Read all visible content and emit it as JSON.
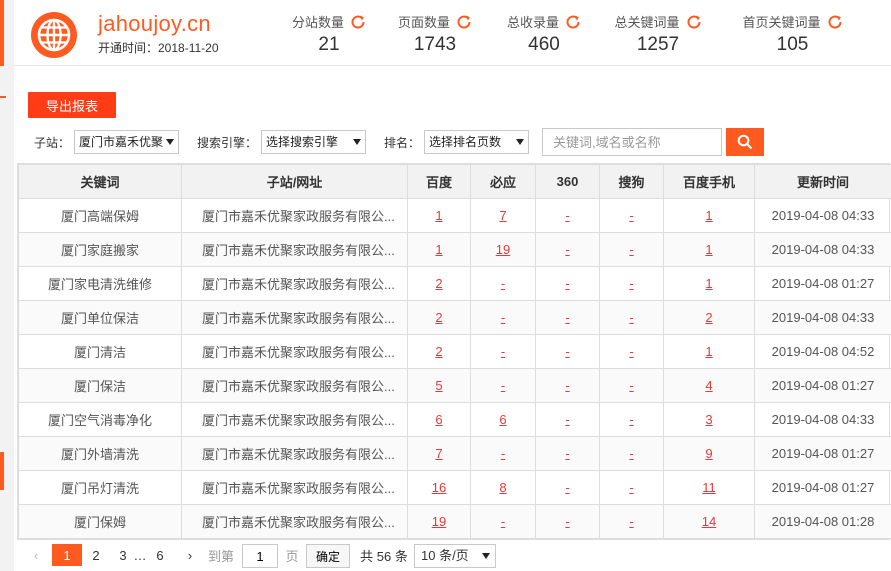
{
  "header": {
    "site_name": "jahoujoy.cn",
    "open_time": "开通时间：2018-11-20",
    "stats": [
      {
        "label": "分站数量",
        "value": "21"
      },
      {
        "label": "页面数量",
        "value": "1743"
      },
      {
        "label": "总收录量",
        "value": "460"
      },
      {
        "label": "总关键词量",
        "value": "1257"
      },
      {
        "label": "首页关键词量",
        "value": "105"
      }
    ]
  },
  "toolbar": {
    "export_label": "导出报表",
    "substation_label": "子站：",
    "substation_value": "厦门市嘉禾优聚",
    "engine_label": "搜索引擎：",
    "engine_value": "选择搜索引擎",
    "rank_label": "排名：",
    "rank_value": "选择排名页数",
    "search_placeholder": "关键词,域名或名称"
  },
  "table": {
    "headers": [
      "关键词",
      "子站/网址",
      "百度",
      "必应",
      "360",
      "搜狗",
      "百度手机",
      "更新时间"
    ],
    "rows": [
      {
        "kw": "厦门高端保姆",
        "site": "厦门市嘉禾优聚家政服务有限公...",
        "baidu": "1",
        "bing": "7",
        "s360": "-",
        "sogou": "-",
        "mobile": "1",
        "time": "2019-04-08 04:33"
      },
      {
        "kw": "厦门家庭搬家",
        "site": "厦门市嘉禾优聚家政服务有限公...",
        "baidu": "1",
        "bing": "19",
        "s360": "-",
        "sogou": "-",
        "mobile": "1",
        "time": "2019-04-08 04:33"
      },
      {
        "kw": "厦门家电清洗维修",
        "site": "厦门市嘉禾优聚家政服务有限公...",
        "baidu": "2",
        "bing": "-",
        "s360": "-",
        "sogou": "-",
        "mobile": "1",
        "time": "2019-04-08 01:27"
      },
      {
        "kw": "厦门单位保洁",
        "site": "厦门市嘉禾优聚家政服务有限公...",
        "baidu": "2",
        "bing": "-",
        "s360": "-",
        "sogou": "-",
        "mobile": "2",
        "time": "2019-04-08 04:33"
      },
      {
        "kw": "厦门清洁",
        "site": "厦门市嘉禾优聚家政服务有限公...",
        "baidu": "2",
        "bing": "-",
        "s360": "-",
        "sogou": "-",
        "mobile": "1",
        "time": "2019-04-08 04:52"
      },
      {
        "kw": "厦门保洁",
        "site": "厦门市嘉禾优聚家政服务有限公...",
        "baidu": "5",
        "bing": "-",
        "s360": "-",
        "sogou": "-",
        "mobile": "4",
        "time": "2019-04-08 01:27"
      },
      {
        "kw": "厦门空气消毒净化",
        "site": "厦门市嘉禾优聚家政服务有限公...",
        "baidu": "6",
        "bing": "6",
        "s360": "-",
        "sogou": "-",
        "mobile": "3",
        "time": "2019-04-08 04:33"
      },
      {
        "kw": "厦门外墙清洗",
        "site": "厦门市嘉禾优聚家政服务有限公...",
        "baidu": "7",
        "bing": "-",
        "s360": "-",
        "sogou": "-",
        "mobile": "9",
        "time": "2019-04-08 01:27"
      },
      {
        "kw": "厦门吊灯清洗",
        "site": "厦门市嘉禾优聚家政服务有限公...",
        "baidu": "16",
        "bing": "8",
        "s360": "-",
        "sogou": "-",
        "mobile": "11",
        "time": "2019-04-08 01:27"
      },
      {
        "kw": "厦门保姆",
        "site": "厦门市嘉禾优聚家政服务有限公...",
        "baidu": "19",
        "bing": "-",
        "s360": "-",
        "sogou": "-",
        "mobile": "14",
        "time": "2019-04-08 01:28"
      }
    ]
  },
  "pager": {
    "prev": "‹",
    "pages": [
      "1",
      "2",
      "3"
    ],
    "ellipsis": "…",
    "last_page": "6",
    "next": "›",
    "goto_label": "到第",
    "goto_value": "1",
    "page_unit": "页",
    "confirm_label": "确定",
    "total_text": "共 56 条",
    "page_size": "10 条/页"
  },
  "colors": {
    "accent": "#ff5a1f",
    "export_button": "#ff3c16",
    "rank_link": "#e4393c"
  },
  "icons": {
    "logo": "globe-icon",
    "refresh": "refresh-icon",
    "search": "search-icon"
  }
}
